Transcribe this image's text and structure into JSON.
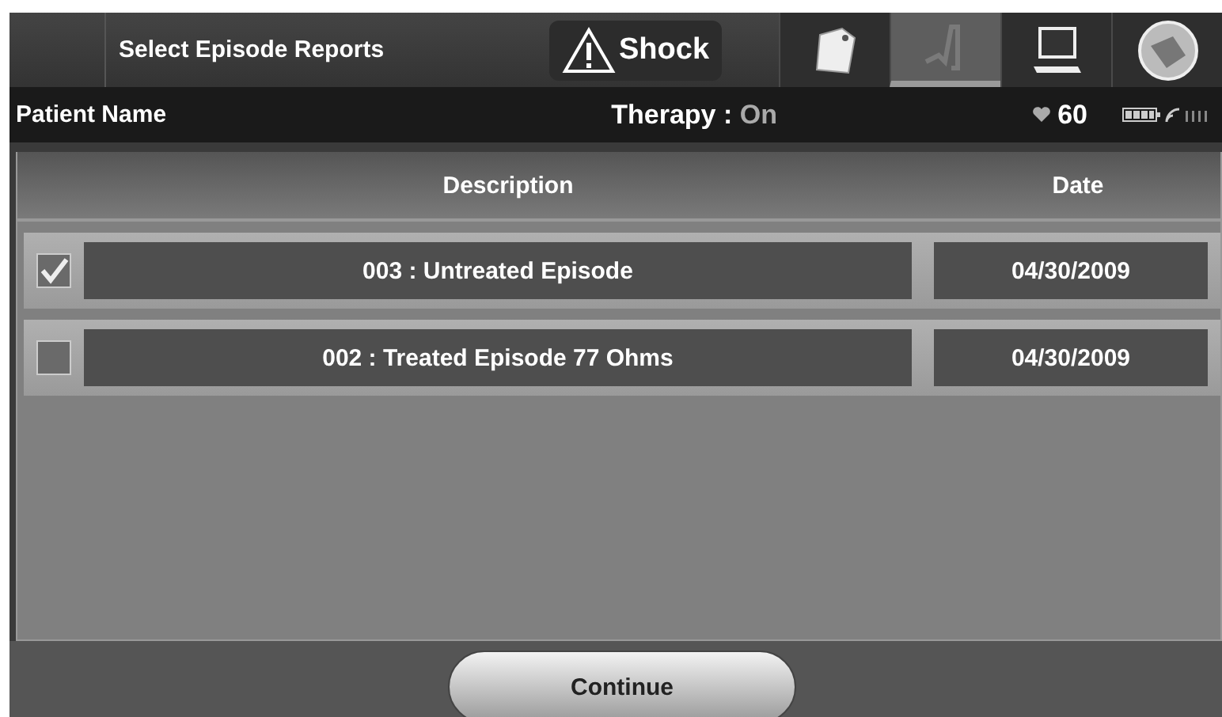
{
  "header": {
    "title": "Select Episode Reports",
    "alert": "Shock"
  },
  "tabs": [
    {
      "kind": "tag",
      "selected": false
    },
    {
      "kind": "chart",
      "selected": true
    },
    {
      "kind": "laptop",
      "selected": false
    },
    {
      "kind": "logo",
      "selected": false
    }
  ],
  "status_bar": {
    "patient": "Patient Name",
    "therapy_label": "Therapy :",
    "therapy_value": "On",
    "heart_rate": "60"
  },
  "table": {
    "columns": [
      "Description",
      "Date"
    ],
    "rows": [
      {
        "description": "003 : Untreated Episode",
        "date": "04/30/2009",
        "checked": true
      },
      {
        "description": "002 : Treated Episode 77 Ohms",
        "date": "04/30/2009",
        "checked": false
      }
    ]
  },
  "buttons": [
    "Continue"
  ]
}
